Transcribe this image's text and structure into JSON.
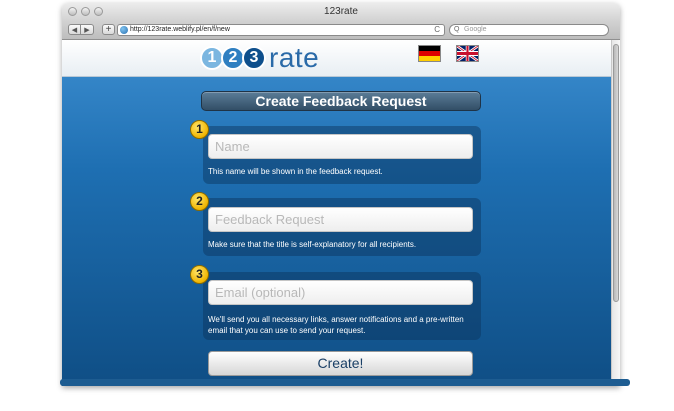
{
  "window": {
    "title": "123rate"
  },
  "browser": {
    "back_icon": "◀",
    "forward_icon": "▶",
    "add_icon": "+",
    "url": "http://123rate.weblify.pl/en/f/new",
    "reload_icon": "C",
    "search_icon": "Q",
    "search_placeholder": "Google"
  },
  "header": {
    "logo": {
      "digits": [
        "1",
        "2",
        "3"
      ],
      "word": "rate"
    },
    "flags": [
      "german-flag",
      "uk-flag"
    ]
  },
  "form": {
    "title": "Create Feedback Request",
    "steps": [
      {
        "number": "1",
        "placeholder": "Name",
        "hint": "This name will be shown in the feedback request."
      },
      {
        "number": "2",
        "placeholder": "Feedback Request",
        "hint": "Make sure that the title is self-explanatory for all recipients."
      },
      {
        "number": "3",
        "placeholder": "Email (optional)",
        "hint": "We'll send you all necessary links, answer notifications and a pre-written email that you can use to send your request."
      }
    ],
    "submit_label": "Create!"
  },
  "colors": {
    "page_blue": "#1e6fb2",
    "badge_yellow": "#f0b400",
    "logo_blue": "#2a6aa8"
  }
}
